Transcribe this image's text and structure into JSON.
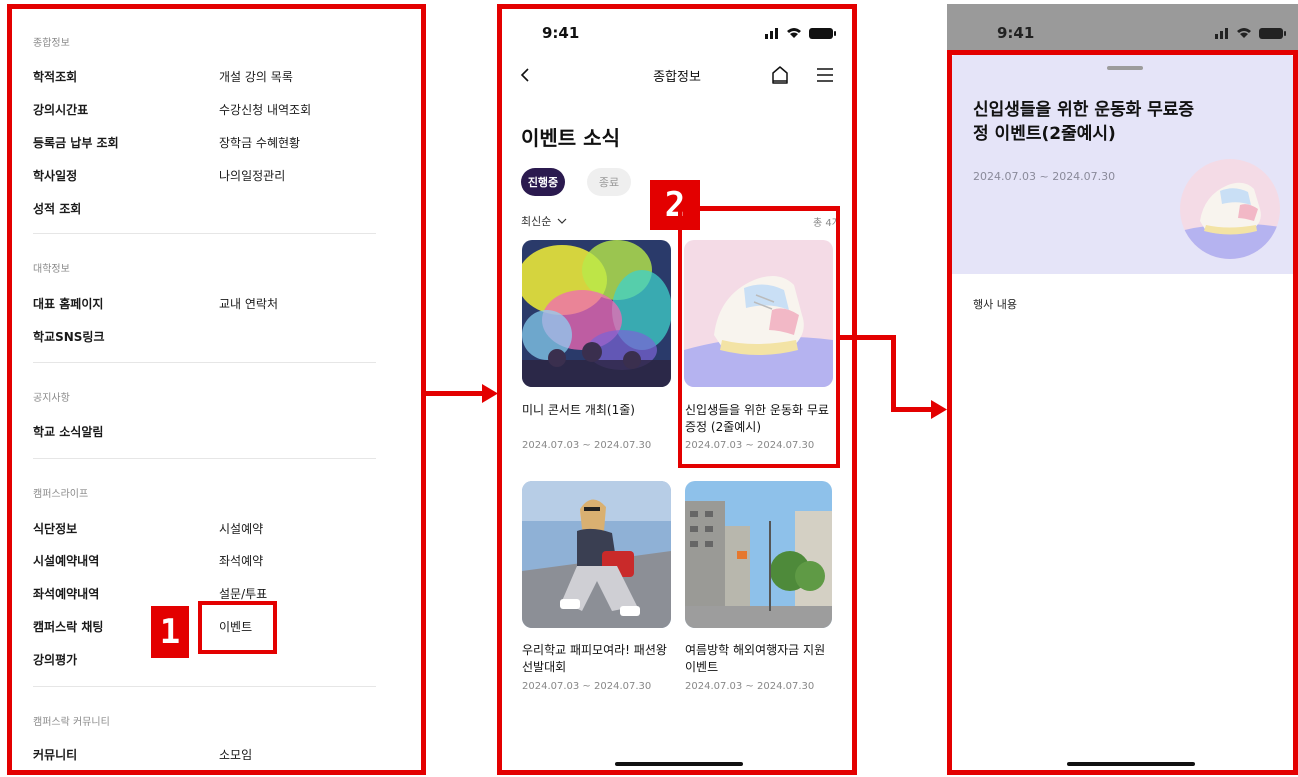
{
  "colors": {
    "accent_red": "#e30000",
    "chip_active": "#2b1a4f",
    "sheet_bg": "#e5e4f8"
  },
  "steps": {
    "one": "1",
    "two": "2"
  },
  "menu": {
    "sections": [
      {
        "title": "종합정보",
        "items": [
          "학적조회",
          "개설 강의 목록",
          "강의시간표",
          "수강신청 내역조회",
          "등록금 납부 조회",
          "장학금 수혜현황",
          "학사일정",
          "나의일정관리",
          "성적 조회"
        ]
      },
      {
        "title": "대학정보",
        "items": [
          "대표 홈페이지",
          "교내 연락처",
          "학교SNS링크"
        ]
      },
      {
        "title": "공지사항",
        "items": [
          "학교 소식알림"
        ]
      },
      {
        "title": "캠퍼스라이프",
        "items": [
          "식단정보",
          "시설예약",
          "시설예약내역",
          "좌석예약",
          "좌석예약내역",
          "설문/투표",
          "캠퍼스락 채팅",
          "이벤트",
          "강의평가"
        ]
      },
      {
        "title": "캠퍼스락 커뮤니티",
        "items": [
          "커뮤니티",
          "소모임"
        ]
      }
    ]
  },
  "event_list": {
    "status_time": "9:41",
    "header_title": "종합정보",
    "page_title": "이벤트 소식",
    "chips": [
      "진행중",
      "종료"
    ],
    "sort_label": "최신순",
    "total_count": "총 4개",
    "cards": [
      {
        "title": "미니 콘서트 개최(1줄)",
        "date": "2024.07.03 ~ 2024.07.30",
        "image": "festival-color-photo"
      },
      {
        "title": "신입생들을 위한 운동화 무료증정 (2줄예시)",
        "date": "2024.07.03 ~ 2024.07.30",
        "image": "sneaker-photo"
      },
      {
        "title": "우리학교 패피모여라! 패션왕 선발대회",
        "date": "2024.07.03 ~ 2024.07.30",
        "image": "fashion-photo"
      },
      {
        "title": "여름방학 해외여행자금 지원 이벤트",
        "date": "2024.07.03 ~ 2024.07.30",
        "image": "city-street-photo"
      }
    ]
  },
  "event_detail": {
    "status_time": "9:41",
    "title": "신입생들을 위한 운동화 무료증정 이벤트(2줄예시)",
    "date": "2024.07.03 ~ 2024.07.30",
    "content_label": "행사 내용"
  }
}
